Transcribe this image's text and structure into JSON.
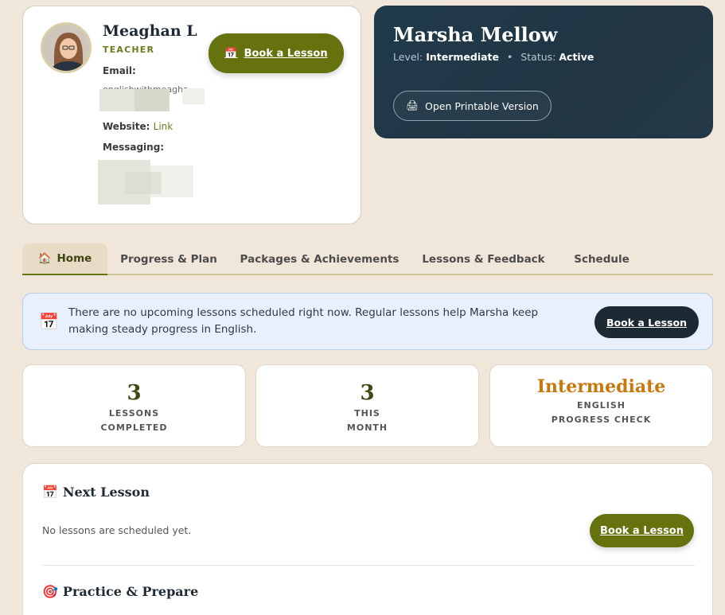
{
  "teacher": {
    "name": "Meaghan L",
    "role": "TEACHER",
    "email_label": "Email:",
    "email_value": "englishwithmeagha...",
    "website_label": "Website:",
    "website_value": "Link",
    "messaging_label": "Messaging:",
    "book_button": "Book a Lesson",
    "book_icon": "calendar-icon"
  },
  "student": {
    "name": "Marsha Mellow",
    "level_label": "Level:",
    "level_value": "Intermediate",
    "status_label": "Status:",
    "status_value": "Active",
    "print_button": "Open Printable Version",
    "print_icon": "printer-icon"
  },
  "tabs": [
    {
      "label": "Home",
      "icon": "home-icon",
      "active": true
    },
    {
      "label": "Progress & Plan"
    },
    {
      "label": "Packages & Achievements"
    },
    {
      "label": "Lessons & Feedback"
    },
    {
      "label": "Schedule"
    }
  ],
  "alert": {
    "text": "There are no upcoming lessons scheduled right now. Regular lessons help Marsha keep making steady progress in English.",
    "button": "Book a Lesson"
  },
  "stats": [
    {
      "value": "3",
      "line1": "LESSONS",
      "line2": "COMPLETED"
    },
    {
      "value": "3",
      "line1": "THIS",
      "line2": "MONTH"
    },
    {
      "value": "Intermediate",
      "line1": "ENGLISH",
      "line2": "PROGRESS CHECK"
    }
  ],
  "next_lesson": {
    "title": "Next Lesson",
    "empty_text": "No lessons are scheduled yet.",
    "button": "Book a Lesson"
  },
  "practice": {
    "title": "Practice & Prepare"
  },
  "colors": {
    "background": "#f1e6da",
    "olive": "#66720e",
    "navy": "#1f3a4a",
    "amber": "#c6790c"
  }
}
